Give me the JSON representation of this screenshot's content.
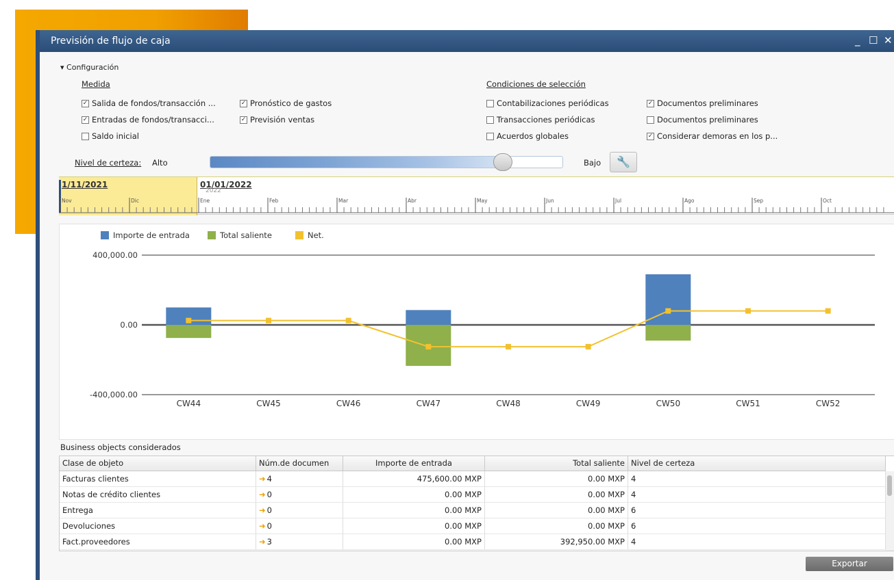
{
  "window": {
    "title": "Previsión de flujo de caja",
    "min": "_",
    "max": "☐",
    "close": "✕"
  },
  "config": {
    "toggle": "▾",
    "label": "Configuración",
    "measure_title": "Medida",
    "selection_title": "Condiciones de selección",
    "measures": [
      {
        "label": "Salida de fondos/transacción ...",
        "checked": true
      },
      {
        "label": "Pronóstico de gastos",
        "checked": true
      },
      {
        "label": "Entradas de fondos/transacci...",
        "checked": true
      },
      {
        "label": "Previsión ventas",
        "checked": true
      },
      {
        "label": "Saldo inicial",
        "checked": false
      }
    ],
    "conditions": [
      {
        "label": "Contabilizaciones periódicas",
        "checked": false
      },
      {
        "label": "Documentos preliminares",
        "checked": true
      },
      {
        "label": "Transacciones periódicas",
        "checked": false
      },
      {
        "label": "Documentos preliminares",
        "checked": false
      },
      {
        "label": "Acuerdos globales",
        "checked": false
      },
      {
        "label": "Considerar demoras en los p...",
        "checked": true
      }
    ],
    "certainty_label": "Nivel de certeza:",
    "certainty_high": "Alto",
    "certainty_low": "Bajo",
    "certainty_level": 0.83
  },
  "timeline": {
    "start": "1/11/2021",
    "current": "01/01/2022",
    "year": "2022",
    "months": [
      "Nov",
      "Dic",
      "Ene",
      "Feb",
      "Mar",
      "Abr",
      "May",
      "Jun",
      "Jul",
      "Ago",
      "Sep",
      "Oct"
    ]
  },
  "chart_data": {
    "type": "bar",
    "categories": [
      "CW44",
      "CW45",
      "CW46",
      "CW47",
      "CW48",
      "CW49",
      "CW50",
      "CW51",
      "CW52"
    ],
    "series": [
      {
        "name": "Importe de entrada",
        "type": "bar",
        "color": "#4f81bd",
        "values": [
          100000,
          0,
          0,
          85000,
          0,
          0,
          290000,
          0,
          0
        ]
      },
      {
        "name": "Total saliente",
        "type": "bar",
        "color": "#8fb04a",
        "values": [
          -75000,
          0,
          0,
          -235000,
          0,
          0,
          -90000,
          0,
          0
        ]
      },
      {
        "name": "Net.",
        "type": "line",
        "color": "#f2c12e",
        "values": [
          25000,
          25000,
          25000,
          -125000,
          -125000,
          -125000,
          80000,
          80000,
          80000
        ]
      }
    ],
    "y_ticks": [
      "400,000.00",
      "0.00",
      "-400,000.00"
    ],
    "ylim": [
      -400000,
      400000
    ],
    "legend": "top-left"
  },
  "table": {
    "caption": "Business objects considerados",
    "columns": [
      "Clase de objeto",
      "Núm.de documen",
      "Importe de entrada",
      "Total saliente",
      "Nivel de certeza"
    ],
    "rows": [
      [
        "Facturas clientes",
        "4",
        "475,600.00 MXP",
        "0.00 MXP",
        "4"
      ],
      [
        "Notas de crédito clientes",
        "0",
        "0.00 MXP",
        "0.00 MXP",
        "4"
      ],
      [
        "Entrega",
        "0",
        "0.00 MXP",
        "0.00 MXP",
        "6"
      ],
      [
        "Devoluciones",
        "0",
        "0.00 MXP",
        "0.00 MXP",
        "6"
      ],
      [
        "Fact.proveedores",
        "3",
        "0.00 MXP",
        "392,950.00 MXP",
        "4"
      ]
    ]
  },
  "export_label": "Exportar",
  "colors": {
    "titlebar": "#2b4d77",
    "accent": "#f5a800",
    "bar_in": "#4f81bd",
    "bar_out": "#8fb04a",
    "net": "#f2c12e"
  }
}
